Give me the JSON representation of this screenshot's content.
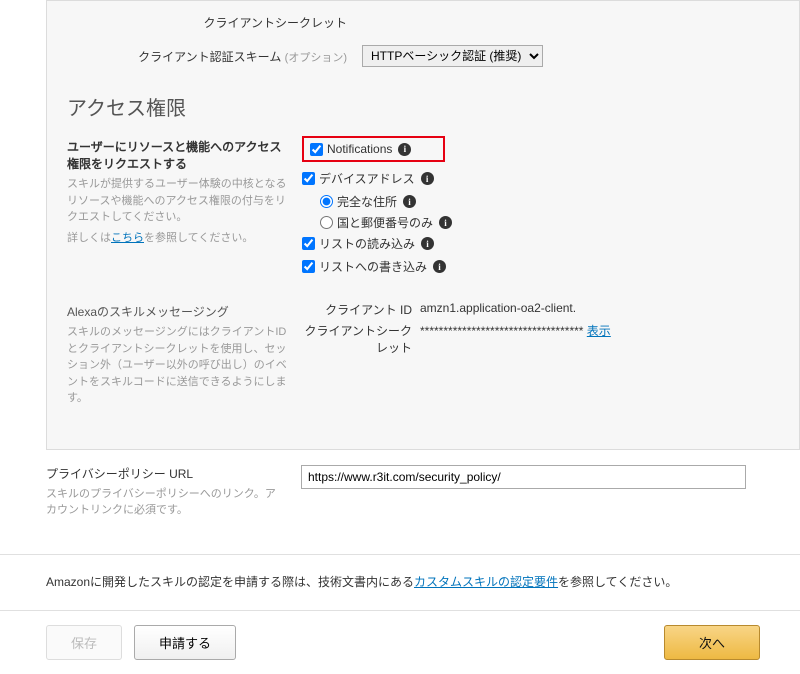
{
  "top_fields": {
    "client_secret_label": "クライアントシークレット",
    "auth_scheme_label": "クライアント認証スキーム",
    "auth_scheme_opt": "(オプション)",
    "auth_scheme_value": "HTTPベーシック認証 (推奨)"
  },
  "access": {
    "title": "アクセス権限",
    "perm_label": "ユーザーにリソースと機能へのアクセス権限をリクエストする",
    "perm_desc": "スキルが提供するユーザー体験の中核となるリソースや機能へのアクセス権限の付与をリクエストしてください。",
    "perm_detail_prefix": "詳しくは",
    "perm_detail_link": "こちら",
    "perm_detail_suffix": "を参照してください。",
    "notifications_label": "Notifications",
    "device_address_label": "デバイスアドレス",
    "full_address_label": "完全な住所",
    "country_postal_label": "国と郵便番号のみ",
    "list_read_label": "リストの読み込み",
    "list_write_label": "リストへの書き込み"
  },
  "messaging": {
    "label": "Alexaのスキルメッセージング",
    "desc": "スキルのメッセージングにはクライアントIDとクライアントシークレットを使用し、セッション外（ユーザー以外の呼び出し）のイベントをスキルコードに送信できるようにします。",
    "client_id_label": "クライアント ID",
    "client_id_value": "amzn1.application-oa2-client.",
    "client_secret_label": "クライアントシークレット",
    "client_secret_mask": "***********************************",
    "show_link": "表示"
  },
  "privacy": {
    "label": "プライバシーポリシー URL",
    "desc": "スキルのプライバシーポリシーへのリンク。アカウントリンクに必須です。",
    "value": "https://www.r3it.com/security_policy/"
  },
  "cert_note": {
    "prefix": "Amazonに開発したスキルの認定を申請する際は、技術文書内にある",
    "link": "カスタムスキルの認定要件",
    "suffix": "を参照してください。"
  },
  "footer": {
    "save": "保存",
    "submit": "申請する",
    "next": "次へ"
  }
}
